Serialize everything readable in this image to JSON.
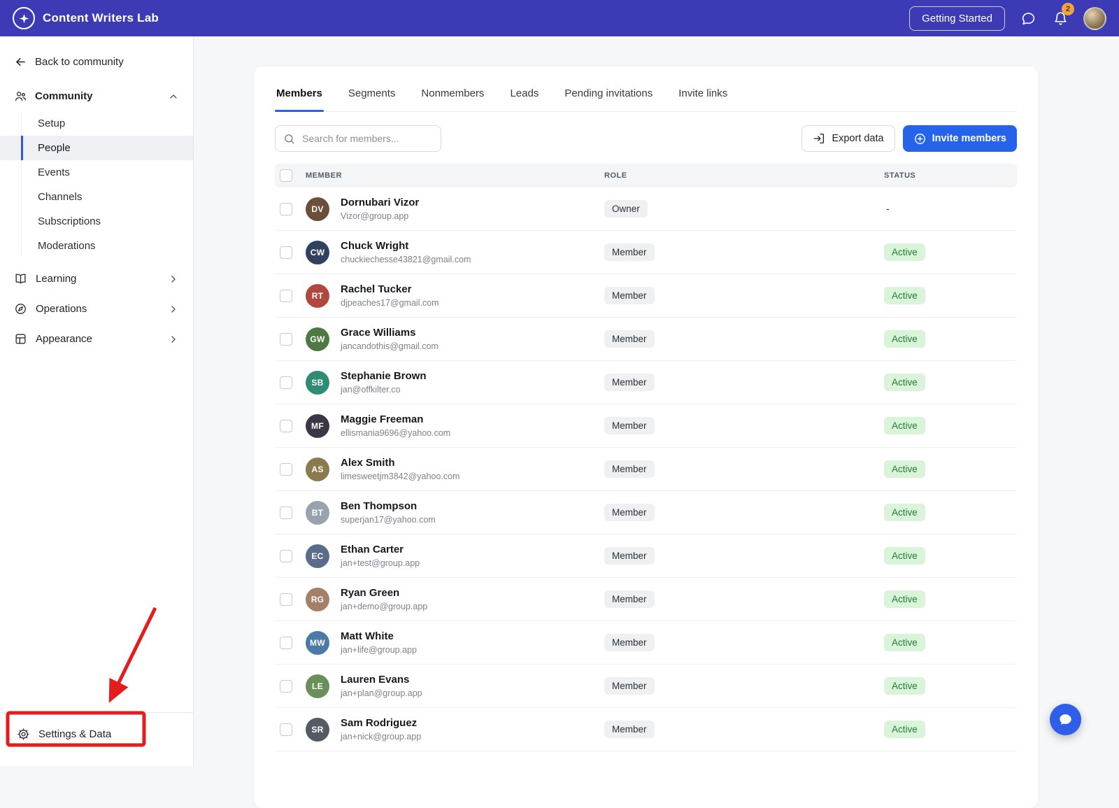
{
  "colors": {
    "topbar_bg": "#3d3ab5",
    "accent_blue": "#2563eb",
    "active_badge_bg": "#d9f4d9",
    "active_badge_text": "#237a38",
    "annotation_red": "#e51c1c"
  },
  "topbar": {
    "brand": "Content Writers Lab",
    "logo_icon": "star-icon",
    "getting_started_label": "Getting Started",
    "messages_icon": "messages-icon",
    "bell_icon": "bell-icon",
    "notification_count": "2"
  },
  "sidebar": {
    "back_label": "Back to community",
    "community": {
      "label": "Community",
      "icon": "people-icon",
      "expanded": true,
      "items": [
        {
          "label": "Setup",
          "selected": false
        },
        {
          "label": "People",
          "selected": true
        },
        {
          "label": "Events",
          "selected": false
        },
        {
          "label": "Channels",
          "selected": false
        },
        {
          "label": "Subscriptions",
          "selected": false
        },
        {
          "label": "Moderations",
          "selected": false
        }
      ]
    },
    "sections": [
      {
        "label": "Learning",
        "icon": "book-icon"
      },
      {
        "label": "Operations",
        "icon": "compass-icon"
      },
      {
        "label": "Appearance",
        "icon": "layout-icon"
      }
    ],
    "settings": {
      "label": "Settings & Data",
      "icon": "gear-icon"
    }
  },
  "main": {
    "tabs": [
      {
        "label": "Members",
        "active": true
      },
      {
        "label": "Segments",
        "active": false
      },
      {
        "label": "Nonmembers",
        "active": false
      },
      {
        "label": "Leads",
        "active": false
      },
      {
        "label": "Pending invitations",
        "active": false
      },
      {
        "label": "Invite links",
        "active": false
      }
    ],
    "search_placeholder": "Search for members...",
    "export_label": "Export data",
    "invite_label": "Invite members",
    "table": {
      "headers": [
        "MEMBER",
        "ROLE",
        "STATUS"
      ],
      "members": [
        {
          "name": "Dornubari Vizor",
          "email": "Vizor@group.app",
          "role": "Owner",
          "status": "-",
          "avatar_bg": "#6b4f3a"
        },
        {
          "name": "Chuck Wright",
          "email": "chuckiechesse43821@gmail.com",
          "role": "Member",
          "status": "Active",
          "avatar_bg": "#30415f"
        },
        {
          "name": "Rachel Tucker",
          "email": "djpeaches17@gmail.com",
          "role": "Member",
          "status": "Active",
          "avatar_bg": "#b0483f"
        },
        {
          "name": "Grace Williams",
          "email": "jancandothis@gmail.com",
          "role": "Member",
          "status": "Active",
          "avatar_bg": "#4f7942"
        },
        {
          "name": "Stephanie Brown",
          "email": "jan@offkilter.co",
          "role": "Member",
          "status": "Active",
          "avatar_bg": "#2e8b74"
        },
        {
          "name": "Maggie Freeman",
          "email": "ellismania9696@yahoo.com",
          "role": "Member",
          "status": "Active",
          "avatar_bg": "#3c3744"
        },
        {
          "name": "Alex Smith",
          "email": "limesweetjm3842@yahoo.com",
          "role": "Member",
          "status": "Active",
          "avatar_bg": "#8a7a4e"
        },
        {
          "name": "Ben Thompson",
          "email": "superjan17@yahoo.com",
          "role": "Member",
          "status": "Active",
          "avatar_bg": "#9aa3ad"
        },
        {
          "name": "Ethan Carter",
          "email": "jan+test@group.app",
          "role": "Member",
          "status": "Active",
          "avatar_bg": "#5a6b8c"
        },
        {
          "name": "Ryan Green",
          "email": "jan+demo@group.app",
          "role": "Member",
          "status": "Active",
          "avatar_bg": "#a4806a"
        },
        {
          "name": "Matt White",
          "email": "jan+life@group.app",
          "role": "Member",
          "status": "Active",
          "avatar_bg": "#4a7ba6"
        },
        {
          "name": "Lauren Evans",
          "email": "jan+plan@group.app",
          "role": "Member",
          "status": "Active",
          "avatar_bg": "#6a8f5a"
        },
        {
          "name": "Sam Rodriguez",
          "email": "jan+nick@group.app",
          "role": "Member",
          "status": "Active",
          "avatar_bg": "#545b63"
        }
      ]
    }
  },
  "chat_launcher": {
    "icon": "chat-bubble-icon"
  }
}
